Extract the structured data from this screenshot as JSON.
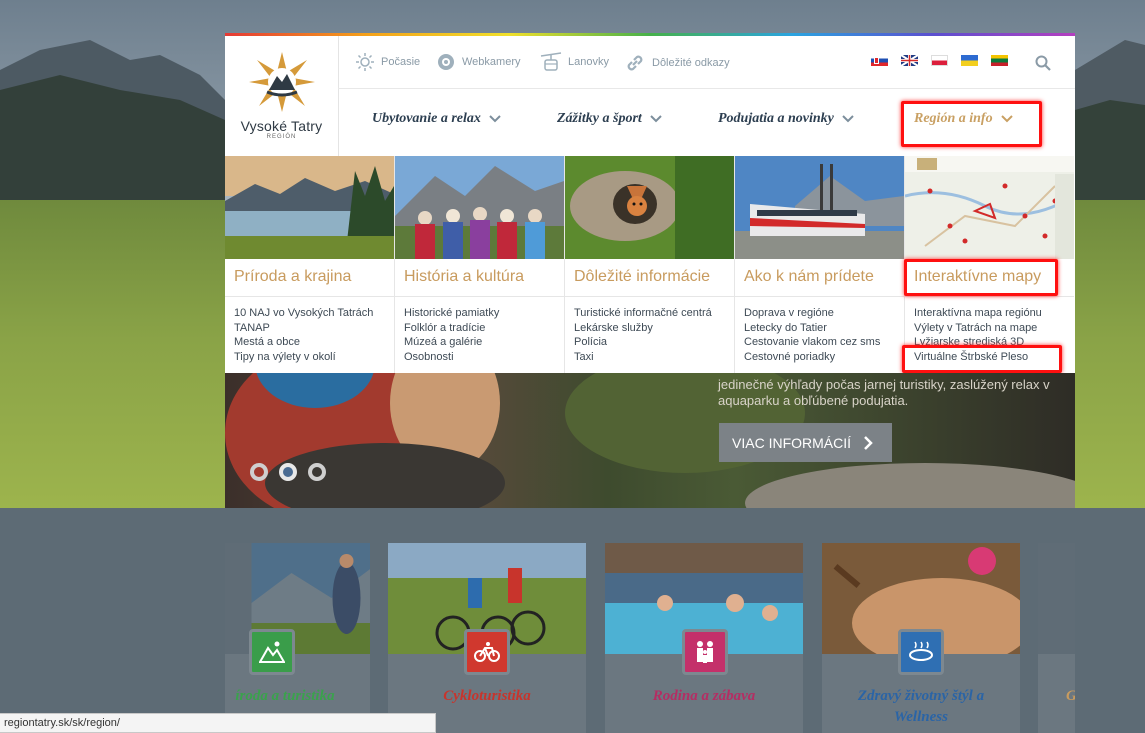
{
  "header": {
    "logo": {
      "title": "Vysoké Tatry",
      "subtitle": "REGIÓN"
    },
    "utility": [
      {
        "label": "Počasie",
        "icon": "sun-icon"
      },
      {
        "label": "Webkamery",
        "icon": "webcam-icon"
      },
      {
        "label": "Lanovky",
        "icon": "cable-car-icon"
      },
      {
        "label": "Dôležité odkazy",
        "icon": "link-icon"
      }
    ],
    "languages": [
      "sk",
      "en",
      "pl",
      "uk",
      "lt"
    ],
    "nav": [
      {
        "label": "Ubytovanie a relax"
      },
      {
        "label": "Zážitky a šport"
      },
      {
        "label": "Podujatia a novinky"
      },
      {
        "label": "Región a info",
        "active": true
      }
    ]
  },
  "mega_menu": [
    {
      "title": "Príroda a krajina",
      "links": [
        "10 NAJ vo Vysokých Tatrách",
        "TANAP",
        "Mestá a obce",
        "Tipy na výlety v okolí"
      ]
    },
    {
      "title": "História a kultúra",
      "links": [
        "Historické pamiatky",
        "Folklór a tradície",
        "Múzeá a galérie",
        "Osobnosti"
      ]
    },
    {
      "title": "Dôležité informácie",
      "links": [
        "Turistické informačné centrá",
        "Lekárske služby",
        "Polícia",
        "Taxi"
      ]
    },
    {
      "title": "Ako k nám prídete",
      "links": [
        "Doprava v regióne",
        "Letecky do Tatier",
        "Cestovanie vlakom cez sms",
        "Cestovné poriadky"
      ]
    },
    {
      "title": "Interaktívne mapy",
      "links": [
        "Interaktívna mapa regiónu",
        "Výlety v Tatrách na mape",
        "Lyžiarske strediská 3D",
        "Virtuálne Štrbské Pleso"
      ]
    }
  ],
  "hero": {
    "text_line1": "jedinečné výhľady počas jarnej turistiky, zaslúžený relax v",
    "text_line2": "aquaparku a obľúbené podujatia.",
    "button": "VIAC INFORMÁCIÍ"
  },
  "cards": [
    {
      "label": "íroda a turistika",
      "color": "#3a9d4a",
      "label_color": "#3aa24c"
    },
    {
      "label": "Cykloturistika",
      "color": "#d0382e",
      "label_color": "#c8342c"
    },
    {
      "label": "Rodina a zábava",
      "color": "#c4306a",
      "label_color": "#b52d63"
    },
    {
      "label": "Zdravý životný štýl a Wellness",
      "label1": "Zdravý životný štýl a",
      "label2": "Wellness",
      "color": "#2f6fb3",
      "label_color": "#2a64a6"
    },
    {
      "label": "G",
      "color": "#c89b5e",
      "label_color": "#c89b5e"
    }
  ],
  "status_bar": {
    "url": "regiontatry.sk/sk/region/"
  },
  "colors": {
    "accent": "#c89b5e",
    "highlight": "#ff1010",
    "nav_text": "#2c3e50"
  }
}
